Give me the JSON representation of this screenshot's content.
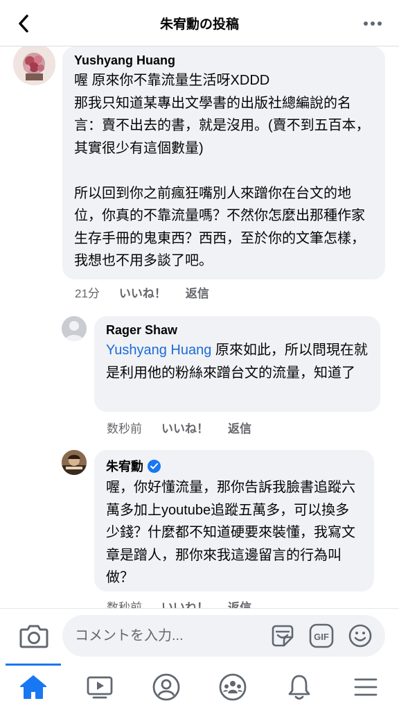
{
  "header": {
    "title": "朱宥勳の投稿"
  },
  "comments": [
    {
      "author": "Yushyang Huang",
      "body": "喔 原來你不靠流量生活呀XDDD\n那我只知道某專出文學書的出版社總編說的名言：賣不出去的書，就是沒用。(賣不到五百本，其實很少有這個數量)\n\n所以回到你之前瘋狂嘴別人來蹭你在台文的地位，你真的不靠流量嗎？不然你怎麼出那種作家生存手冊的鬼東西？西西，至於你的文筆怎樣，我想也不用多談了吧。",
      "time": "21分",
      "like": "いいね！",
      "reply": "返信"
    },
    {
      "author": "Rager  Shaw",
      "mention": "Yushyang Huang",
      "body": " 原來如此，所以問現在就是利用他的粉絲來蹭台文的流量，知道了",
      "time": "数秒前",
      "like": "いいね！",
      "reply": "返信"
    },
    {
      "author": "朱宥勳",
      "verified": true,
      "body": "喔，你好懂流量，那你告訴我臉書追蹤六萬多加上youtube追蹤五萬多，可以換多少錢？什麼都不知道硬要來裝懂，我寫文章是蹭人，那你來我這邊留言的行為叫做？",
      "time": "数秒前",
      "like": "いいね！",
      "reply": "返信"
    }
  ],
  "composer": {
    "placeholder": "コメントを入力...",
    "gif_label": "GIF"
  },
  "nav": {
    "active": "home",
    "items": [
      "home",
      "watch",
      "profile",
      "groups",
      "notifications",
      "menu"
    ]
  },
  "colors": {
    "accent": "#1877f2",
    "mention": "#1b6ad8",
    "bubble": "#f0f2f5",
    "secondary_text": "#65676b"
  }
}
